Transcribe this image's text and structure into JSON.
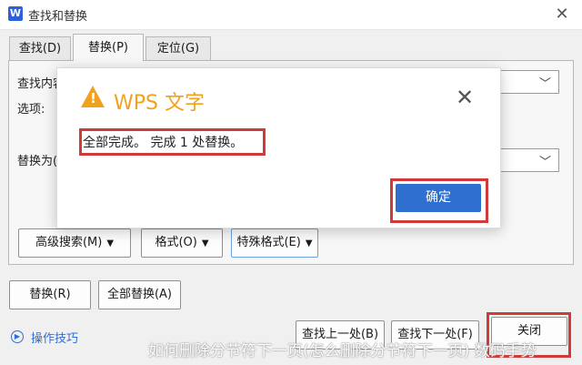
{
  "window": {
    "icon_letter": "W",
    "title": "查找和替换",
    "close_glyph": "✕"
  },
  "tabs": [
    {
      "label": "查找(D)"
    },
    {
      "label": "替换(P)"
    },
    {
      "label": "定位(G)"
    }
  ],
  "find": {
    "label": "查找内容"
  },
  "options": {
    "label": "选项:"
  },
  "replace": {
    "label": "替换为("
  },
  "buttons": {
    "advanced": "高级搜索(M)",
    "format": "格式(O)",
    "special": "特殊格式(E)",
    "replace": "替换(R)",
    "replace_all": "全部替换(A)",
    "find_prev": "查找上一处(B)",
    "find_next": "查找下一处(F)",
    "close": "关闭"
  },
  "tips": {
    "label": "操作技巧"
  },
  "dialog": {
    "title": "WPS 文字",
    "warning_glyph": "!",
    "close_glyph": "✕",
    "message": "全部完成。 完成 1 处替换。",
    "ok_label": "确定"
  },
  "watermark": "如何删除分节符下一页(怎么删除分节符下一页) 数码手势"
}
